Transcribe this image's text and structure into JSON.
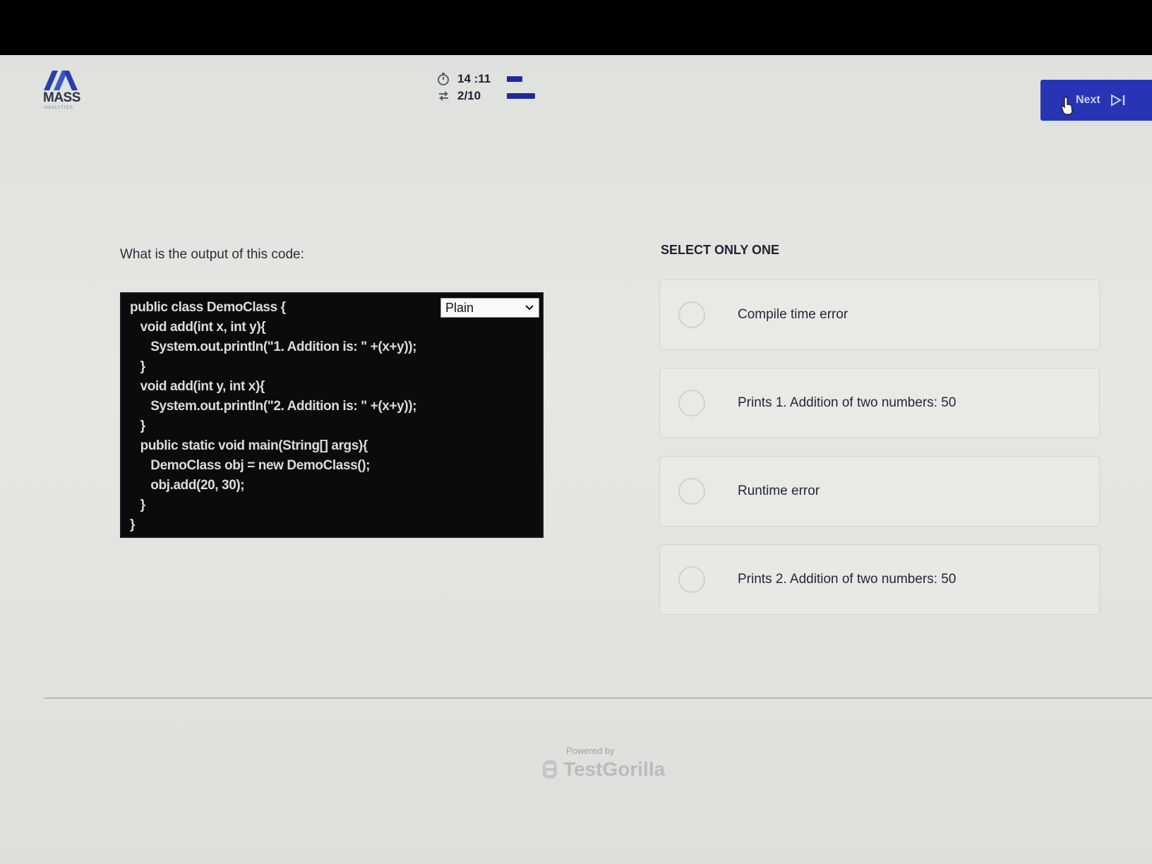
{
  "header": {
    "logo_text": "MASS",
    "logo_sub": "ANALYTICS",
    "timer": "14 :11",
    "progress": "2/10",
    "timer_fraction": 0.5,
    "progress_fraction": 0.2,
    "next_label": "Next"
  },
  "question": {
    "prompt": "What is the output of this code:",
    "code_lines": [
      "public class DemoClass {",
      "   void add(int x, int y){",
      "      System.out.println(\"1. Addition is: \" +(x+y));",
      "   }",
      "   void add(int y, int x){",
      "      System.out.println(\"2. Addition is: \" +(x+y));",
      "   }",
      "   public static void main(String[] args){",
      "      DemoClass obj = new DemoClass();",
      "      obj.add(20, 30);",
      "   }",
      "}"
    ],
    "language_select": "Plain"
  },
  "answers": {
    "instruction": "SELECT ONLY ONE",
    "options": [
      "Compile time error",
      "Prints 1. Addition of two numbers: 50",
      "Runtime error",
      "Prints 2. Addition of two numbers: 50"
    ]
  },
  "footer": {
    "powered_by": "Powered by",
    "brand": "TestGorilla"
  },
  "colors": {
    "accent": "#2735b4",
    "bar": "#1e2a9a",
    "code_bg": "#0b0b0d"
  }
}
